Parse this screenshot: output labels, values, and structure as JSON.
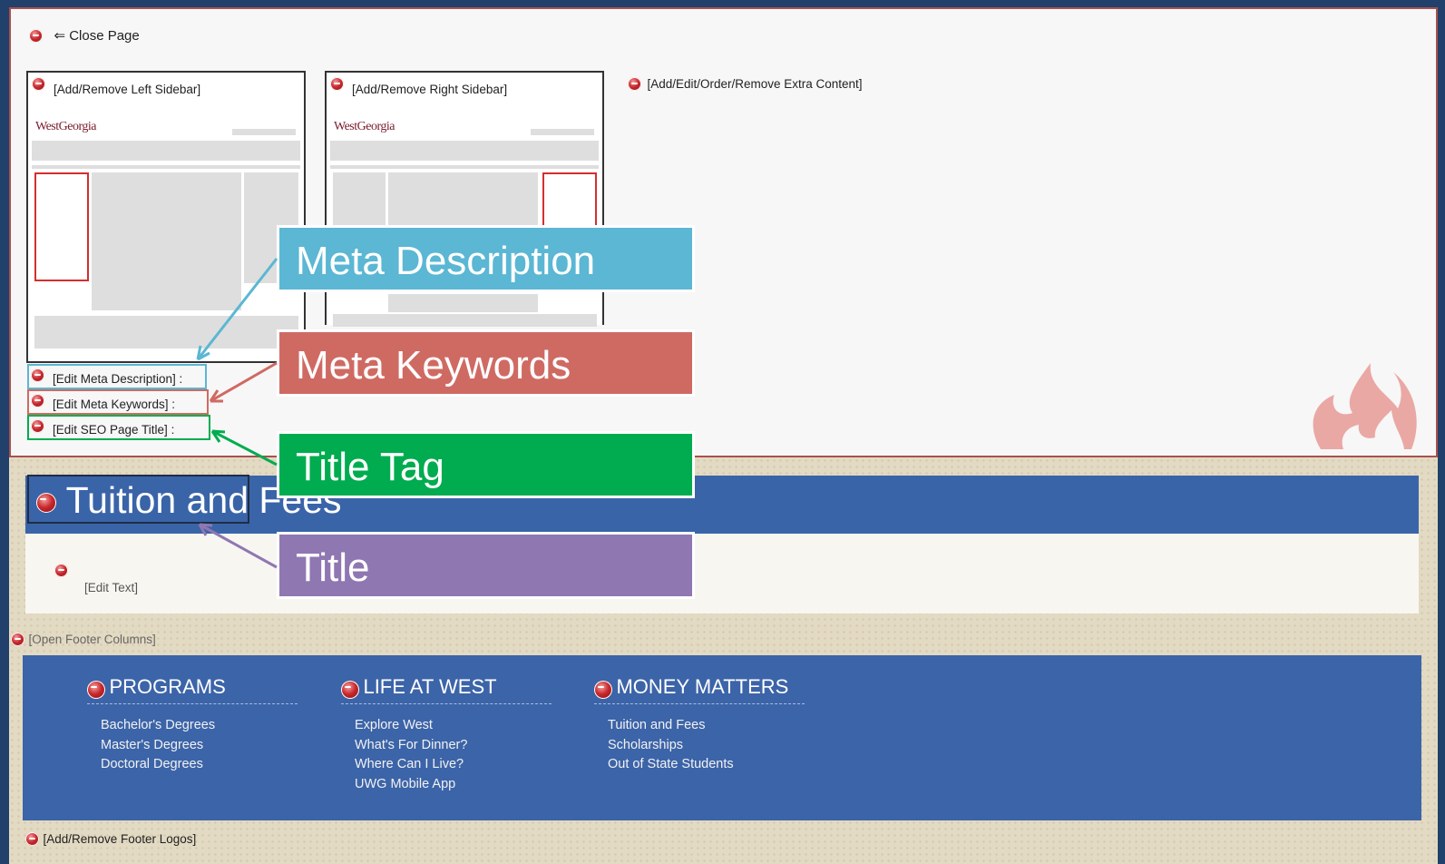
{
  "cms": {
    "close_page": "⇐ Close Page",
    "left_sidebar": "[Add/Remove Left Sidebar]",
    "right_sidebar": "[Add/Remove Right Sidebar]",
    "extra_content": "[Add/Edit/Order/Remove Extra Content]",
    "thumb_logo": "WestGeorgia",
    "edit_meta_description": "[Edit Meta Description] :",
    "edit_meta_keywords": "[Edit Meta Keywords] :",
    "edit_seo_title": "[Edit SEO Page Title] :"
  },
  "callouts": [
    {
      "label": "Meta Description",
      "color": "#5bb7d3"
    },
    {
      "label": "Meta Keywords",
      "color": "#cf6a63"
    },
    {
      "label": "Title Tag",
      "color": "#00ac4f"
    },
    {
      "label": "Title",
      "color": "#8f77b2"
    }
  ],
  "page": {
    "title": "Tuition and Fees",
    "edit_text": "[Edit Text]",
    "open_footer_columns": "[Open Footer Columns]"
  },
  "footer": {
    "columns": [
      {
        "heading": "PROGRAMS",
        "items": [
          "Bachelor's Degrees",
          "Master's Degrees",
          "Doctoral Degrees"
        ]
      },
      {
        "heading": "LIFE AT WEST",
        "items": [
          "Explore West",
          "What's For Dinner?",
          "Where Can I Live?",
          "UWG Mobile App"
        ]
      },
      {
        "heading": "MONEY MATTERS",
        "items": [
          "Tuition and Fees",
          "Scholarships",
          "Out of State Students"
        ]
      }
    ],
    "logos_link": "[Add/Remove Footer Logos]"
  },
  "colors": {
    "background": "#21406b",
    "title_bar": "#3a64a8",
    "footer": "#3c64a8",
    "panel_border": "#a9504d"
  }
}
